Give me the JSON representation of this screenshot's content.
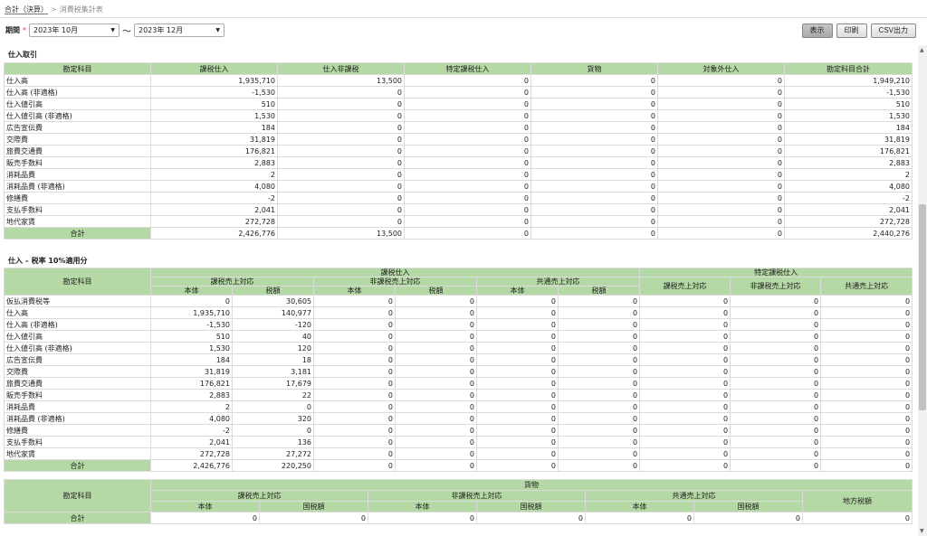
{
  "breadcrumb": {
    "parent": "合計（決算）",
    "separator": ">",
    "current": "消費税集計表"
  },
  "period": {
    "label": "期間",
    "required": "*",
    "from": "2023年 10月",
    "tilde": "～",
    "to": "2023年 12月"
  },
  "buttons": {
    "show": "表示",
    "print": "印刷",
    "csv": "CSV出力"
  },
  "section1": {
    "title": "仕入取引",
    "headers": [
      "勘定科目",
      "課税仕入",
      "仕入非課税",
      "特定課税仕入",
      "貨物",
      "対象外仕入",
      "勘定科目合計"
    ],
    "rows": [
      [
        "仕入高",
        "1,935,710",
        "13,500",
        "0",
        "0",
        "0",
        "1,949,210"
      ],
      [
        "仕入高 (非適格)",
        "-1,530",
        "0",
        "0",
        "0",
        "0",
        "-1,530"
      ],
      [
        "仕入値引高",
        "510",
        "0",
        "0",
        "0",
        "0",
        "510"
      ],
      [
        "仕入値引高 (非適格)",
        "1,530",
        "0",
        "0",
        "0",
        "0",
        "1,530"
      ],
      [
        "広告宣伝費",
        "184",
        "0",
        "0",
        "0",
        "0",
        "184"
      ],
      [
        "交際費",
        "31,819",
        "0",
        "0",
        "0",
        "0",
        "31,819"
      ],
      [
        "旅費交通費",
        "176,821",
        "0",
        "0",
        "0",
        "0",
        "176,821"
      ],
      [
        "販売手数料",
        "2,883",
        "0",
        "0",
        "0",
        "0",
        "2,883"
      ],
      [
        "消耗品費",
        "2",
        "0",
        "0",
        "0",
        "0",
        "2"
      ],
      [
        "消耗品費 (非適格)",
        "4,080",
        "0",
        "0",
        "0",
        "0",
        "4,080"
      ],
      [
        "修繕費",
        "-2",
        "0",
        "0",
        "0",
        "0",
        "-2"
      ],
      [
        "支払手数料",
        "2,041",
        "0",
        "0",
        "0",
        "0",
        "2,041"
      ],
      [
        "地代家賃",
        "272,728",
        "0",
        "0",
        "0",
        "0",
        "272,728"
      ]
    ],
    "total": [
      "合計",
      "2,426,776",
      "13,500",
      "0",
      "0",
      "0",
      "2,440,276"
    ]
  },
  "section2": {
    "title": "仕入 – 税率 10%適用分",
    "h_account": "勘定科目",
    "h_taxable": "課税仕入",
    "h_specific": "特定課税仕入",
    "h_sub": [
      "課税売上対応",
      "非課税売上対応",
      "共通売上対応"
    ],
    "h_leaf": [
      "本体",
      "税額"
    ],
    "h_spec": [
      "課税売上対応",
      "非課税売上対応",
      "共通売上対応"
    ],
    "rows": [
      [
        "仮払消費税等",
        "0",
        "30,605",
        "0",
        "0",
        "0",
        "0",
        "0",
        "0",
        "0"
      ],
      [
        "仕入高",
        "1,935,710",
        "140,977",
        "0",
        "0",
        "0",
        "0",
        "0",
        "0",
        "0"
      ],
      [
        "仕入高 (非適格)",
        "-1,530",
        "-120",
        "0",
        "0",
        "0",
        "0",
        "0",
        "0",
        "0"
      ],
      [
        "仕入値引高",
        "510",
        "40",
        "0",
        "0",
        "0",
        "0",
        "0",
        "0",
        "0"
      ],
      [
        "仕入値引高 (非適格)",
        "1,530",
        "120",
        "0",
        "0",
        "0",
        "0",
        "0",
        "0",
        "0"
      ],
      [
        "広告宣伝費",
        "184",
        "18",
        "0",
        "0",
        "0",
        "0",
        "0",
        "0",
        "0"
      ],
      [
        "交際費",
        "31,819",
        "3,181",
        "0",
        "0",
        "0",
        "0",
        "0",
        "0",
        "0"
      ],
      [
        "旅費交通費",
        "176,821",
        "17,679",
        "0",
        "0",
        "0",
        "0",
        "0",
        "0",
        "0"
      ],
      [
        "販売手数料",
        "2,883",
        "22",
        "0",
        "0",
        "0",
        "0",
        "0",
        "0",
        "0"
      ],
      [
        "消耗品費",
        "2",
        "0",
        "0",
        "0",
        "0",
        "0",
        "0",
        "0",
        "0"
      ],
      [
        "消耗品費 (非適格)",
        "4,080",
        "320",
        "0",
        "0",
        "0",
        "0",
        "0",
        "0",
        "0"
      ],
      [
        "修繕費",
        "-2",
        "0",
        "0",
        "0",
        "0",
        "0",
        "0",
        "0",
        "0"
      ],
      [
        "支払手数料",
        "2,041",
        "136",
        "0",
        "0",
        "0",
        "0",
        "0",
        "0",
        "0"
      ],
      [
        "地代家賃",
        "272,728",
        "27,272",
        "0",
        "0",
        "0",
        "0",
        "0",
        "0",
        "0"
      ]
    ],
    "total": [
      "合計",
      "2,426,776",
      "220,250",
      "0",
      "0",
      "0",
      "0",
      "0",
      "0",
      "0"
    ]
  },
  "section3": {
    "h_account": "勘定科目",
    "h_cargo": "貨物",
    "h_sub": [
      "課税売上対応",
      "非課税売上対応",
      "共通売上対応"
    ],
    "h_leaf": [
      "本体",
      "国税額"
    ],
    "h_local": "地方税額",
    "total": [
      "合計",
      "0",
      "0",
      "0",
      "0",
      "0",
      "0",
      "0"
    ]
  }
}
